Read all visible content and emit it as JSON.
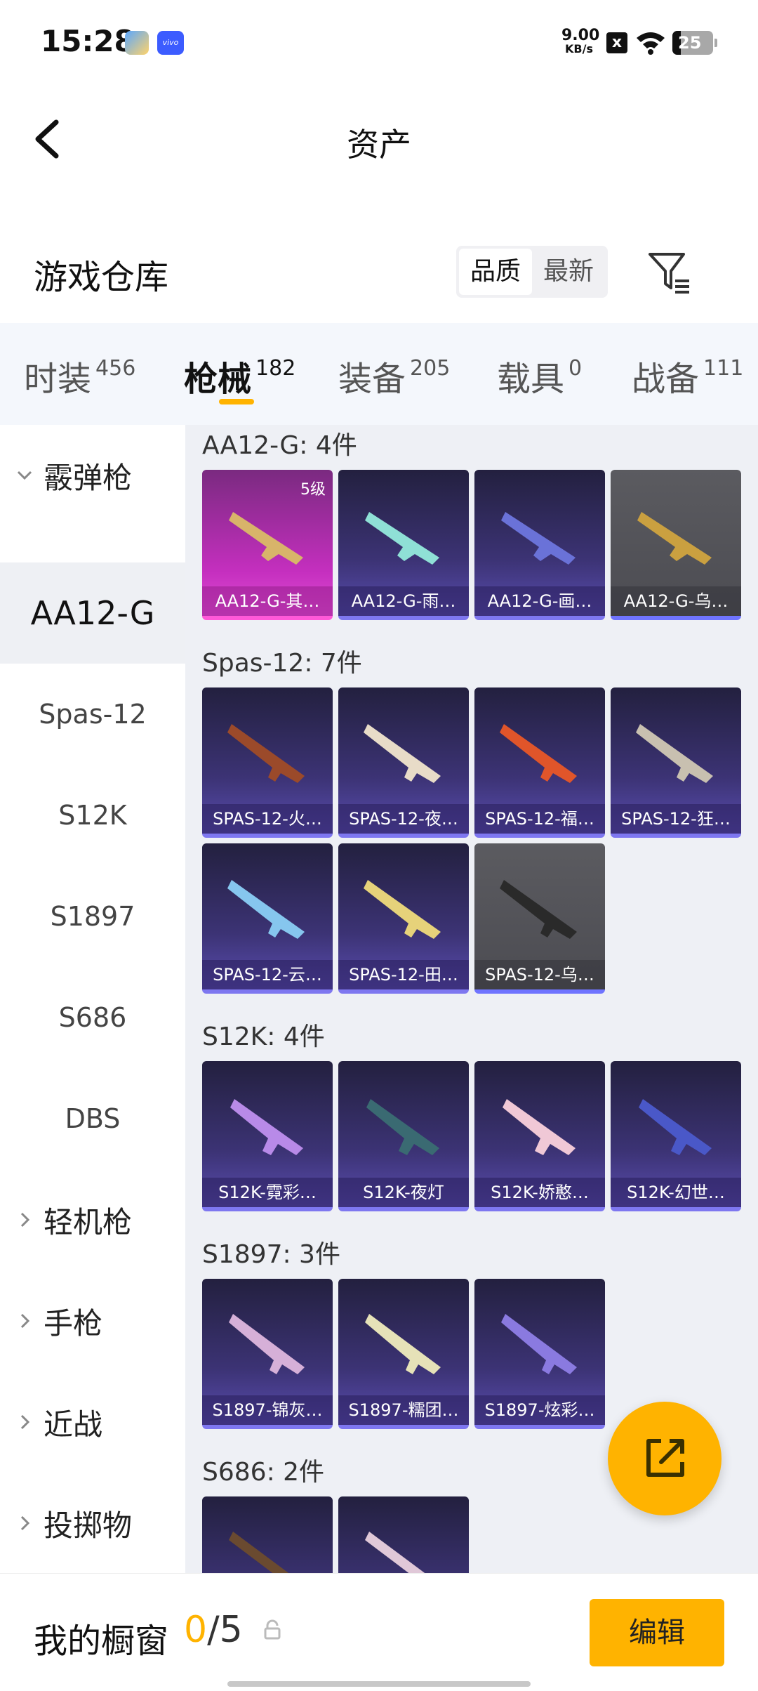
{
  "status": {
    "time": "15:28",
    "app2_label": "vivo",
    "net_value": "9.00",
    "net_unit": "KB/s",
    "x_badge": "x",
    "battery": "25"
  },
  "header": {
    "title": "资产"
  },
  "warehouse": {
    "title": "游戏仓库",
    "sort_options": [
      "品质",
      "最新"
    ],
    "active_sort": "品质"
  },
  "tabs": [
    {
      "label": "时装",
      "count": "456"
    },
    {
      "label": "枪械",
      "count": "182"
    },
    {
      "label": "装备",
      "count": "205"
    },
    {
      "label": "载具",
      "count": "0"
    },
    {
      "label": "战备",
      "count": "111"
    }
  ],
  "sidebar": {
    "category_open": "霰弹枪",
    "items": [
      "AA12-G",
      "Spas-12",
      "S12K",
      "S1897",
      "S686",
      "DBS"
    ],
    "active": "AA12-G",
    "categories_closed": [
      "轻机枪",
      "手枪",
      "近战",
      "投掷物"
    ]
  },
  "sections": [
    {
      "title": "AA12-G: 4件",
      "items": [
        {
          "name": "AA12-G-其…",
          "level": "5级"
        },
        {
          "name": "AA12-G-雨…"
        },
        {
          "name": "AA12-G-画…"
        },
        {
          "name": "AA12-G-乌…"
        }
      ]
    },
    {
      "title": "Spas-12: 7件",
      "items": [
        {
          "name": "SPAS-12-火…"
        },
        {
          "name": "SPAS-12-夜…"
        },
        {
          "name": "SPAS-12-福…"
        },
        {
          "name": "SPAS-12-狂…"
        },
        {
          "name": "SPAS-12-云…"
        },
        {
          "name": "SPAS-12-田…"
        },
        {
          "name": "SPAS-12-乌…"
        }
      ]
    },
    {
      "title": "S12K: 4件",
      "items": [
        {
          "name": "S12K-霓彩…"
        },
        {
          "name": "S12K-夜灯"
        },
        {
          "name": "S12K-娇憨…"
        },
        {
          "name": "S12K-幻世…"
        }
      ]
    },
    {
      "title": "S1897: 3件",
      "items": [
        {
          "name": "S1897-锦灰…"
        },
        {
          "name": "S1897-糯团…"
        },
        {
          "name": "S1897-炫彩…"
        }
      ]
    },
    {
      "title": "S686: 2件",
      "items": []
    }
  ],
  "bottom": {
    "title": "我的橱窗",
    "current": "0",
    "separator": "/",
    "total": "5",
    "edit_label": "编辑"
  },
  "colors": {
    "accent": "#ffb300",
    "card_purple": "#3c3375",
    "card_pink": "#c52fbf",
    "card_gray": "#4c4c52"
  }
}
